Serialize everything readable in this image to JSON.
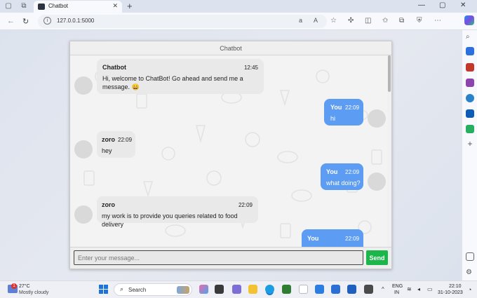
{
  "browser": {
    "tab_title": "Chatbot",
    "url": "127.0.0.1:5000"
  },
  "chat": {
    "header_title": "Chatbot",
    "messages": [
      {
        "sender": "bot",
        "name": "Chatbot",
        "time": "12:45",
        "text_line1": "Hi, welcome to ChatBot! Go ahead and send me a",
        "text_line2": "message. 😄"
      },
      {
        "sender": "me",
        "name": "You",
        "time": "22:09",
        "text": "hi"
      },
      {
        "sender": "bot",
        "name": "zoro",
        "time": "22:09",
        "text": "hey"
      },
      {
        "sender": "me",
        "name": "You",
        "time": "22:09",
        "text": "what doing?"
      },
      {
        "sender": "bot",
        "name": "zoro",
        "time": "22:09",
        "text": "my work is to provide you queries related to food delivery"
      },
      {
        "sender": "me",
        "name": "You",
        "time": "22:09",
        "text": ""
      }
    ],
    "input_placeholder": "Enter your message...",
    "send_label": "Send"
  },
  "taskbar": {
    "weather_badge": "1",
    "weather_temp": "27°C",
    "weather_desc": "Mostly cloudy",
    "search_label": "Search",
    "lang_line1": "ENG",
    "lang_line2": "IN",
    "time": "22:10",
    "date": "31-10-2023"
  },
  "colors": {
    "user_bubble": "#5d9cf3",
    "bot_bubble": "#e9e9e9",
    "send_button": "#1cb64a",
    "accent": "#1c74d8"
  }
}
